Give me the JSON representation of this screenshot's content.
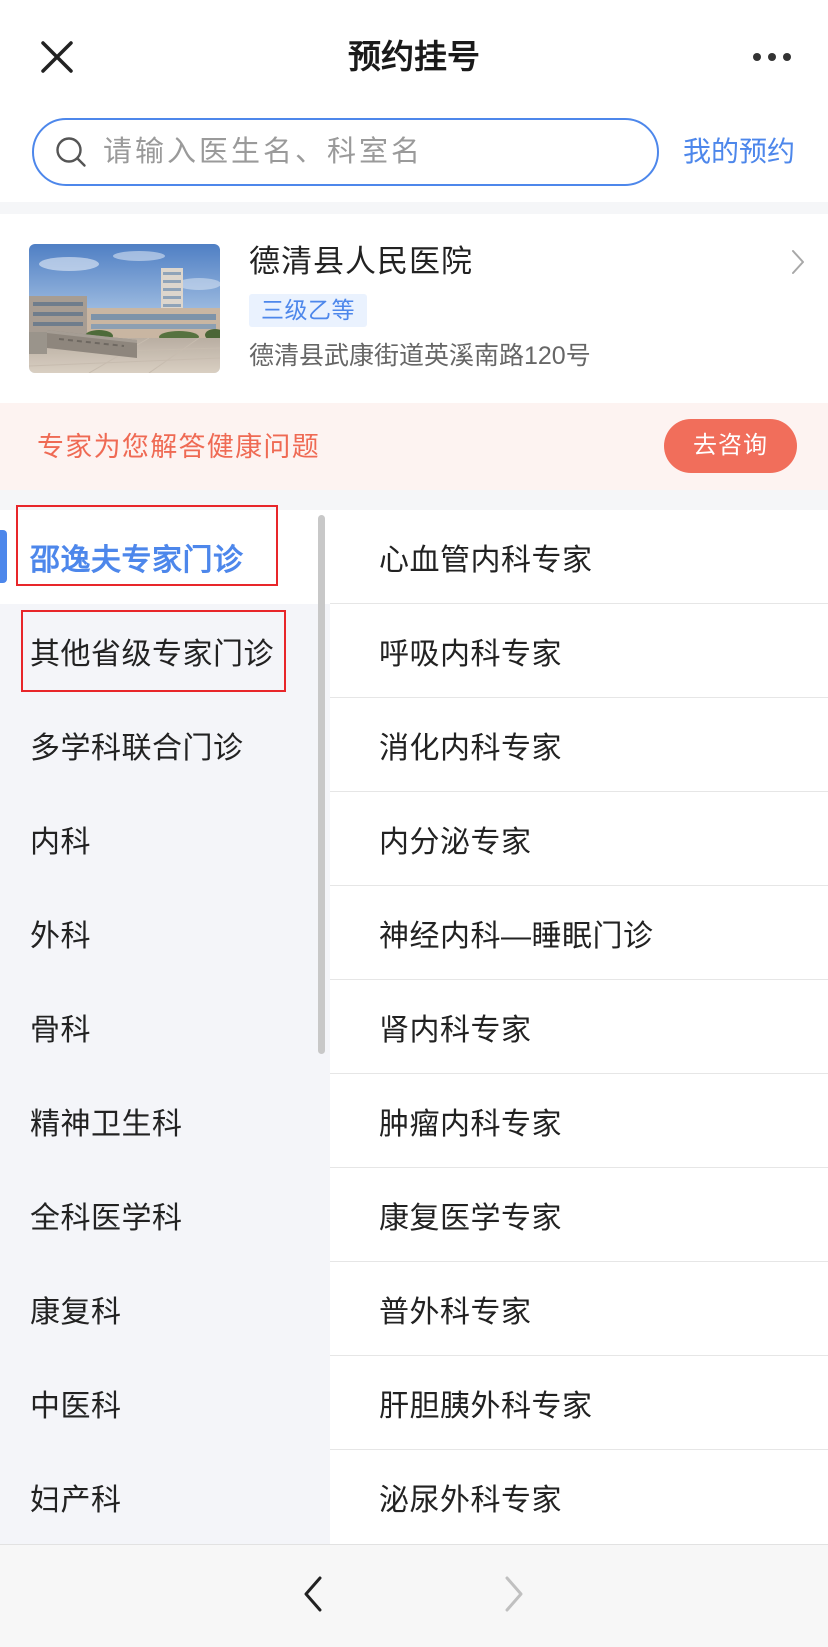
{
  "header": {
    "title": "预约挂号",
    "close_icon": "close-icon",
    "more_icon": "more-icon"
  },
  "search": {
    "icon": "search-icon",
    "placeholder": "请输入医生名、科室名",
    "value": "",
    "my_appointments_label": "我的预约"
  },
  "hospital": {
    "name": "德清县人民医院",
    "level": "三级乙等",
    "address": "德清县武康街道英溪南路120号",
    "chevron_icon": "chevron-right-icon"
  },
  "banner": {
    "text": "专家为您解答健康问题",
    "button_label": "去咨询"
  },
  "departments": {
    "selected_index": 0,
    "items": [
      {
        "label": "邵逸夫专家门诊"
      },
      {
        "label": "其他省级专家门诊"
      },
      {
        "label": "多学科联合门诊"
      },
      {
        "label": "内科"
      },
      {
        "label": "外科"
      },
      {
        "label": "骨科"
      },
      {
        "label": "精神卫生科"
      },
      {
        "label": "全科医学科"
      },
      {
        "label": "康复科"
      },
      {
        "label": "中医科"
      },
      {
        "label": "妇产科"
      }
    ]
  },
  "sub_departments": {
    "items": [
      {
        "label": "心血管内科专家"
      },
      {
        "label": "呼吸内科专家"
      },
      {
        "label": "消化内科专家"
      },
      {
        "label": "内分泌专家"
      },
      {
        "label": "神经内科—睡眠门诊"
      },
      {
        "label": "肾内科专家"
      },
      {
        "label": "肿瘤内科专家"
      },
      {
        "label": "康复医学专家"
      },
      {
        "label": "普外科专家"
      },
      {
        "label": "肝胆胰外科专家"
      },
      {
        "label": "泌尿外科专家"
      }
    ]
  },
  "bottom_nav": {
    "back_icon": "chevron-left-icon",
    "forward_icon": "chevron-right-icon",
    "back_enabled": true,
    "forward_enabled": false
  },
  "colors": {
    "accent": "#4d87eb",
    "banner_text": "#ef6a54",
    "consult_button": "#f16e5b",
    "annotation": "#e8262a"
  }
}
